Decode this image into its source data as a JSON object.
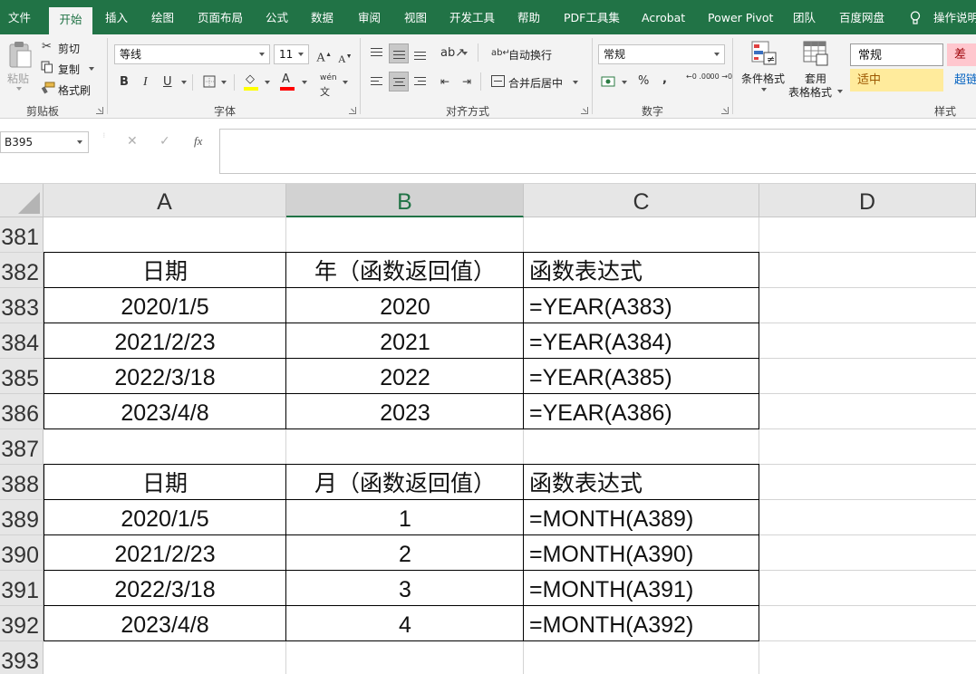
{
  "ribbon_tabs": [
    {
      "label": "文件",
      "active": false
    },
    {
      "label": "开始",
      "active": true
    },
    {
      "label": "插入",
      "active": false
    },
    {
      "label": "绘图",
      "active": false
    },
    {
      "label": "页面布局",
      "active": false
    },
    {
      "label": "公式",
      "active": false
    },
    {
      "label": "数据",
      "active": false
    },
    {
      "label": "审阅",
      "active": false
    },
    {
      "label": "视图",
      "active": false
    },
    {
      "label": "开发工具",
      "active": false
    },
    {
      "label": "帮助",
      "active": false
    },
    {
      "label": "PDF工具集",
      "active": false
    },
    {
      "label": "Acrobat",
      "active": false
    },
    {
      "label": "Power Pivot",
      "active": false
    },
    {
      "label": "团队",
      "active": false
    },
    {
      "label": "百度网盘",
      "active": false
    }
  ],
  "tell_me": "操作说明",
  "clipboard": {
    "group_label": "剪贴板",
    "paste": "粘贴",
    "cut": "剪切",
    "copy": "复制",
    "format_painter": "格式刷"
  },
  "font": {
    "group_label": "字体",
    "font_name": "等线",
    "font_size": "11",
    "grow": "A",
    "shrink": "A",
    "bold": "B",
    "italic": "I",
    "underline": "U",
    "fill_glyph": "◇",
    "font_color_glyph": "A",
    "phonetic": "wén",
    "fill_color": "#ffff00",
    "font_color": "#ff0000"
  },
  "alignment": {
    "group_label": "对齐方式",
    "wrap_text": "自动换行",
    "merge_center": "合并后居中"
  },
  "number": {
    "group_label": "数字",
    "format": "常规",
    "percent": "%",
    "comma": ",",
    "inc_decimal": "←0 .00",
    "dec_decimal": ".00 →0"
  },
  "styles": {
    "group_label": "样式",
    "conditional_formatting": "条件格式",
    "format_as_table_1": "套用",
    "format_as_table_2": "表格格式",
    "cells": [
      {
        "label": "常规",
        "bg": "#ffffff",
        "color": "#111111"
      },
      {
        "label": "差",
        "bg": "#ffc7ce",
        "color": "#9c0006"
      },
      {
        "label": "适中",
        "bg": "#ffeb9c",
        "color": "#9c5700"
      },
      {
        "label": "超链",
        "bg": "#f3f3f3",
        "color": "#0563c1"
      }
    ]
  },
  "formula_bar": {
    "name_box": "B395",
    "cancel_glyph": "✕",
    "enter_glyph": "✓",
    "fx": "fx",
    "formula": ""
  },
  "sheet": {
    "columns": [
      "A",
      "B",
      "C",
      "D"
    ],
    "selected_column": "B",
    "rows": [
      {
        "num": "381",
        "a": "",
        "b": "",
        "c": ""
      },
      {
        "num": "382",
        "a": "日期",
        "b": "年（函数返回值）",
        "c": "函数表达式"
      },
      {
        "num": "383",
        "a": "2020/1/5",
        "b": "2020",
        "c": "=YEAR(A383)"
      },
      {
        "num": "384",
        "a": "2021/2/23",
        "b": "2021",
        "c": "=YEAR(A384)"
      },
      {
        "num": "385",
        "a": "2022/3/18",
        "b": "2022",
        "c": "=YEAR(A385)"
      },
      {
        "num": "386",
        "a": "2023/4/8",
        "b": "2023",
        "c": "=YEAR(A386)"
      },
      {
        "num": "387",
        "a": "",
        "b": "",
        "c": ""
      },
      {
        "num": "388",
        "a": "日期",
        "b": "月（函数返回值）",
        "c": "函数表达式"
      },
      {
        "num": "389",
        "a": "2020/1/5",
        "b": "1",
        "c": "=MONTH(A389)"
      },
      {
        "num": "390",
        "a": "2021/2/23",
        "b": "2",
        "c": "=MONTH(A390)"
      },
      {
        "num": "391",
        "a": "2022/3/18",
        "b": "3",
        "c": "=MONTH(A391)"
      },
      {
        "num": "392",
        "a": "2023/4/8",
        "b": "4",
        "c": "=MONTH(A392)"
      },
      {
        "num": "393",
        "a": "",
        "b": "",
        "c": ""
      }
    ]
  },
  "colors": {
    "ribbon_green": "#217346",
    "ribbon_bg": "#f3f3f3",
    "header_bg": "#e6e6e6",
    "gridline": "#d4d4d4"
  }
}
